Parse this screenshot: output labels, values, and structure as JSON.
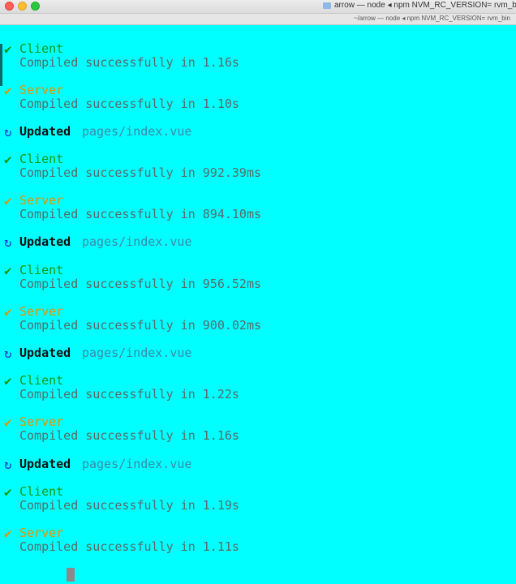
{
  "window": {
    "title": "arrow — node ◂ npm NVM_RC_VERSION= rvm_bin_path",
    "tab_title": "~/arrow — node ◂ npm NVM_RC_VERSION= rvm_bin",
    "background": "#00ffff"
  },
  "icons": {
    "check": "✔",
    "update": "↻"
  },
  "log": [
    {
      "kind": "build",
      "label": "Client",
      "message": "Compiled successfully in 1.16s"
    },
    {
      "kind": "build",
      "label": "Server",
      "message": "Compiled successfully in 1.10s"
    },
    {
      "kind": "update",
      "label": "Updated",
      "path": "pages/index.vue"
    },
    {
      "kind": "build",
      "label": "Client",
      "message": "Compiled successfully in 992.39ms"
    },
    {
      "kind": "build",
      "label": "Server",
      "message": "Compiled successfully in 894.10ms"
    },
    {
      "kind": "update",
      "label": "Updated",
      "path": "pages/index.vue"
    },
    {
      "kind": "build",
      "label": "Client",
      "message": "Compiled successfully in 956.52ms"
    },
    {
      "kind": "build",
      "label": "Server",
      "message": "Compiled successfully in 900.02ms"
    },
    {
      "kind": "update",
      "label": "Updated",
      "path": "pages/index.vue"
    },
    {
      "kind": "build",
      "label": "Client",
      "message": "Compiled successfully in 1.22s"
    },
    {
      "kind": "build",
      "label": "Server",
      "message": "Compiled successfully in 1.16s"
    },
    {
      "kind": "update",
      "label": "Updated",
      "path": "pages/index.vue"
    },
    {
      "kind": "build",
      "label": "Client",
      "message": "Compiled successfully in 1.19s"
    },
    {
      "kind": "build",
      "label": "Server",
      "message": "Compiled successfully in 1.11s"
    }
  ],
  "colors": {
    "client": "#139a13",
    "server": "#e39400",
    "message": "#5a6a6a",
    "update_icon": "#2533d6",
    "path": "#3b8aa8"
  }
}
